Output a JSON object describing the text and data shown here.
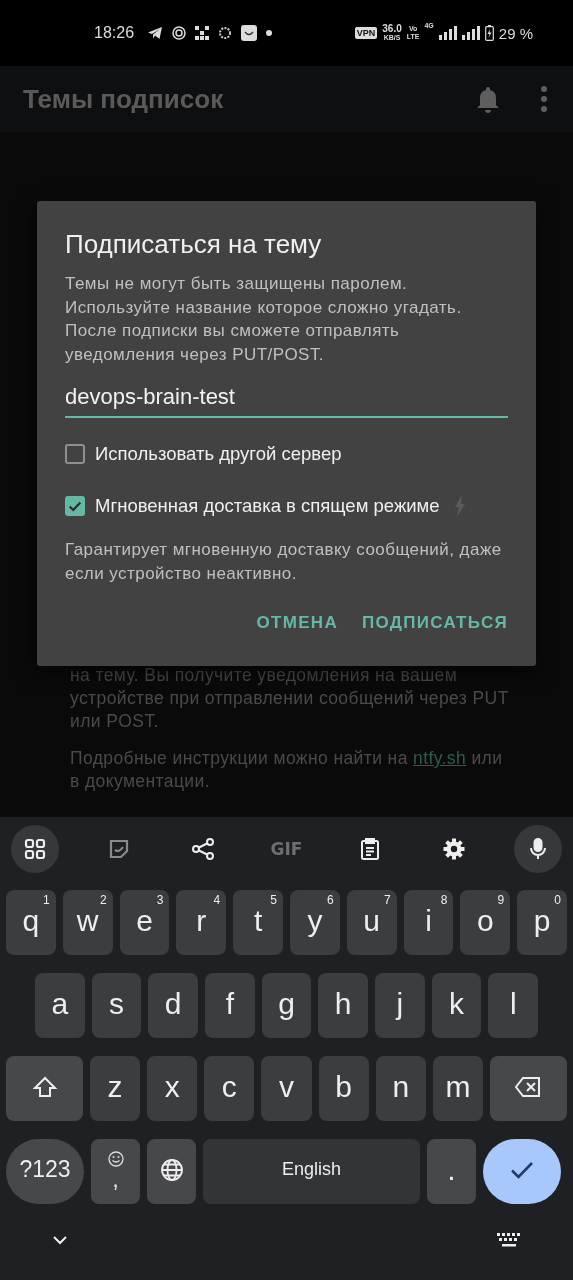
{
  "status_bar": {
    "time": "18:26",
    "vpn": "VPN",
    "speed": "36.0",
    "speed_unit": "KB/S",
    "volte_top": "Vo",
    "volte_bottom": "LTE",
    "network": "4G",
    "battery": "29 %"
  },
  "app_bar": {
    "title": "Темы подписок"
  },
  "background": {
    "paragraphs": [
      {
        "text": "на тему. Вы получите уведомления на вашем устройстве при отправлении сообщений через PUT или POST."
      },
      {
        "text": "Подробные инструкции можно найти на",
        "link": "ntfy.sh",
        "after": "или в документации."
      }
    ]
  },
  "dialog": {
    "title": "Подписаться на тему",
    "description": "Темы не могут быть защищены паролем. Используйте название которое сложно угадать. После подписки вы сможете отправлять уведомления через PUT/POST.",
    "topic_field": {
      "value": "devops-brain-test"
    },
    "options": [
      {
        "label": "Использовать другой сервер",
        "checked": false,
        "bolt": false
      },
      {
        "label": "Мгновенная доставка в спящем режиме",
        "checked": true,
        "bolt": true
      }
    ],
    "note": "Гарантирует мгновенную доставку сообщений, даже если устройство неактивно.",
    "buttons": [
      {
        "label": "ОТМЕНА"
      },
      {
        "label": "ПОДПИСАТЬСЯ"
      }
    ]
  },
  "keyboard": {
    "toolbar": [
      {
        "kind": "grid",
        "disabled": false
      },
      {
        "kind": "sticker",
        "disabled": true
      },
      {
        "kind": "share",
        "disabled": false
      },
      {
        "kind": "gif",
        "label": "GIF",
        "disabled": true
      },
      {
        "kind": "clipboard",
        "disabled": false
      },
      {
        "kind": "settings",
        "disabled": false
      },
      {
        "kind": "mic",
        "disabled": false
      }
    ],
    "rows": [
      {
        "keys": [
          {
            "kind": "letter",
            "label": "q",
            "hint": "1"
          },
          {
            "kind": "letter",
            "label": "w",
            "hint": "2"
          },
          {
            "kind": "letter",
            "label": "e",
            "hint": "3"
          },
          {
            "kind": "letter",
            "label": "r",
            "hint": "4"
          },
          {
            "kind": "letter",
            "label": "t",
            "hint": "5"
          },
          {
            "kind": "letter",
            "label": "y",
            "hint": "6"
          },
          {
            "kind": "letter",
            "label": "u",
            "hint": "7"
          },
          {
            "kind": "letter",
            "label": "i",
            "hint": "8"
          },
          {
            "kind": "letter",
            "label": "o",
            "hint": "9"
          },
          {
            "kind": "letter",
            "label": "p",
            "hint": "0"
          }
        ]
      },
      {
        "keys": [
          {
            "kind": "letter",
            "label": "a"
          },
          {
            "kind": "letter",
            "label": "s"
          },
          {
            "kind": "letter",
            "label": "d"
          },
          {
            "kind": "letter",
            "label": "f"
          },
          {
            "kind": "letter",
            "label": "g"
          },
          {
            "kind": "letter",
            "label": "h"
          },
          {
            "kind": "letter",
            "label": "j"
          },
          {
            "kind": "letter",
            "label": "k"
          },
          {
            "kind": "letter",
            "label": "l"
          }
        ]
      },
      {
        "keys": [
          {
            "kind": "shift"
          },
          {
            "kind": "letter",
            "label": "z"
          },
          {
            "kind": "letter",
            "label": "x"
          },
          {
            "kind": "letter",
            "label": "c"
          },
          {
            "kind": "letter",
            "label": "v"
          },
          {
            "kind": "letter",
            "label": "b"
          },
          {
            "kind": "letter",
            "label": "n"
          },
          {
            "kind": "letter",
            "label": "m"
          },
          {
            "kind": "backspace"
          }
        ]
      },
      {
        "keys": [
          {
            "kind": "symbols",
            "label": "?123"
          },
          {
            "kind": "emoji",
            "label": ","
          },
          {
            "kind": "globe"
          },
          {
            "kind": "space",
            "label": "English"
          },
          {
            "kind": "period",
            "label": "."
          },
          {
            "kind": "enter"
          }
        ]
      }
    ]
  }
}
